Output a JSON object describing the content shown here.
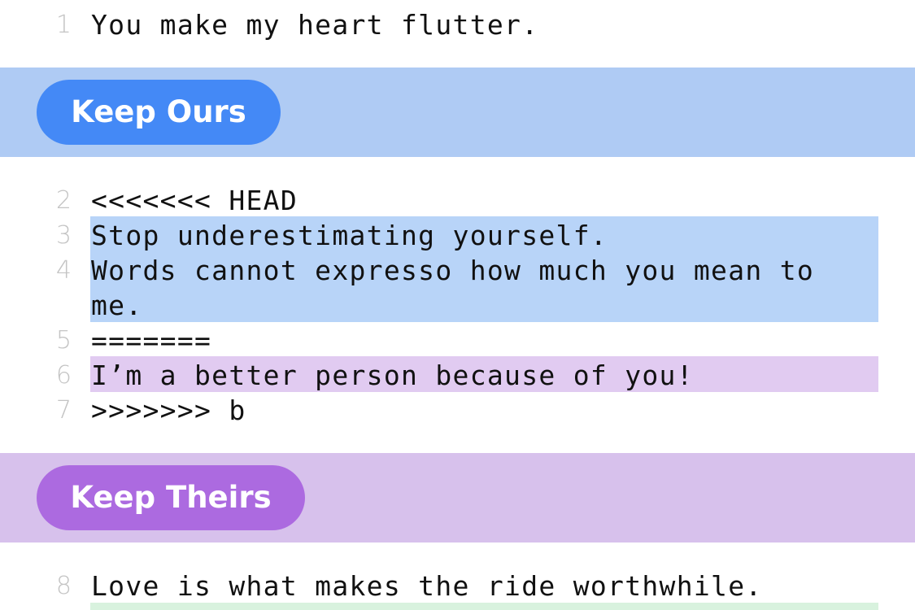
{
  "colors": {
    "ours_band": "#afcbf4",
    "ours_button": "#4489f6",
    "ours_highlight": "#b8d4f8",
    "theirs_band": "#d7c1ec",
    "theirs_button": "#ac6ae0",
    "theirs_highlight": "#e1cbf1",
    "added_highlight": "#d8f2de"
  },
  "top_line": {
    "number": "1",
    "text": "You make my heart flutter."
  },
  "ours_action": {
    "label": "Keep Ours"
  },
  "conflict": {
    "lines": [
      {
        "number": "2",
        "text": "<<<<<<< HEAD"
      },
      {
        "number": "3",
        "text": "Stop underestimating yourself."
      },
      {
        "number": "4",
        "text": "Words cannot expresso how much you mean to"
      },
      {
        "number": "",
        "text": "me."
      },
      {
        "number": "5",
        "text": "======="
      },
      {
        "number": "6",
        "text": "I’m a better person because of you!"
      },
      {
        "number": "7",
        "text": ">>>>>>> b"
      }
    ]
  },
  "theirs_action": {
    "label": "Keep Theirs"
  },
  "bottom_line": {
    "number": "8",
    "text": "Love is what makes the ride worthwhile."
  }
}
